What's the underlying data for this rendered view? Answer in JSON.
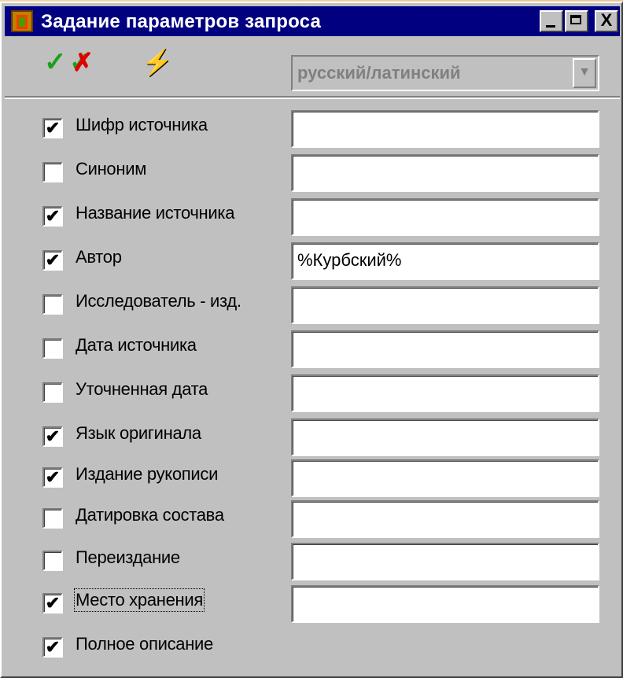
{
  "window": {
    "title": "Задание параметров запроса",
    "close_symbol": "X"
  },
  "toolbar": {
    "ok_icon": "✓",
    "cancel_icon_check": "✓",
    "cancel_icon_cross": "✗",
    "run_icon": "⚡",
    "language_value": "русский/латинский",
    "dropdown_arrow": "▼"
  },
  "fields": [
    {
      "label": "Шифр источника",
      "checked": true,
      "value": ""
    },
    {
      "label": "Синоним",
      "checked": false,
      "value": ""
    },
    {
      "label": "Название источника",
      "checked": true,
      "value": ""
    },
    {
      "label": "Автор",
      "checked": true,
      "value": "%Курбский%"
    },
    {
      "label": "Исследователь - изд.",
      "checked": false,
      "value": ""
    },
    {
      "label": "Дата источника",
      "checked": false,
      "value": ""
    },
    {
      "label": "Уточненная дата",
      "checked": false,
      "value": ""
    },
    {
      "label": "Язык оригинала",
      "checked": true,
      "value": ""
    },
    {
      "label": "Издание рукописи",
      "checked": true,
      "value": ""
    },
    {
      "label": "Датировка состава",
      "checked": false,
      "value": ""
    },
    {
      "label": "Переиздание",
      "checked": false,
      "value": ""
    },
    {
      "label": "Место хранения",
      "checked": true,
      "value": ""
    },
    {
      "label": "Полное описание",
      "checked": true
    }
  ],
  "check_mark": "✔"
}
